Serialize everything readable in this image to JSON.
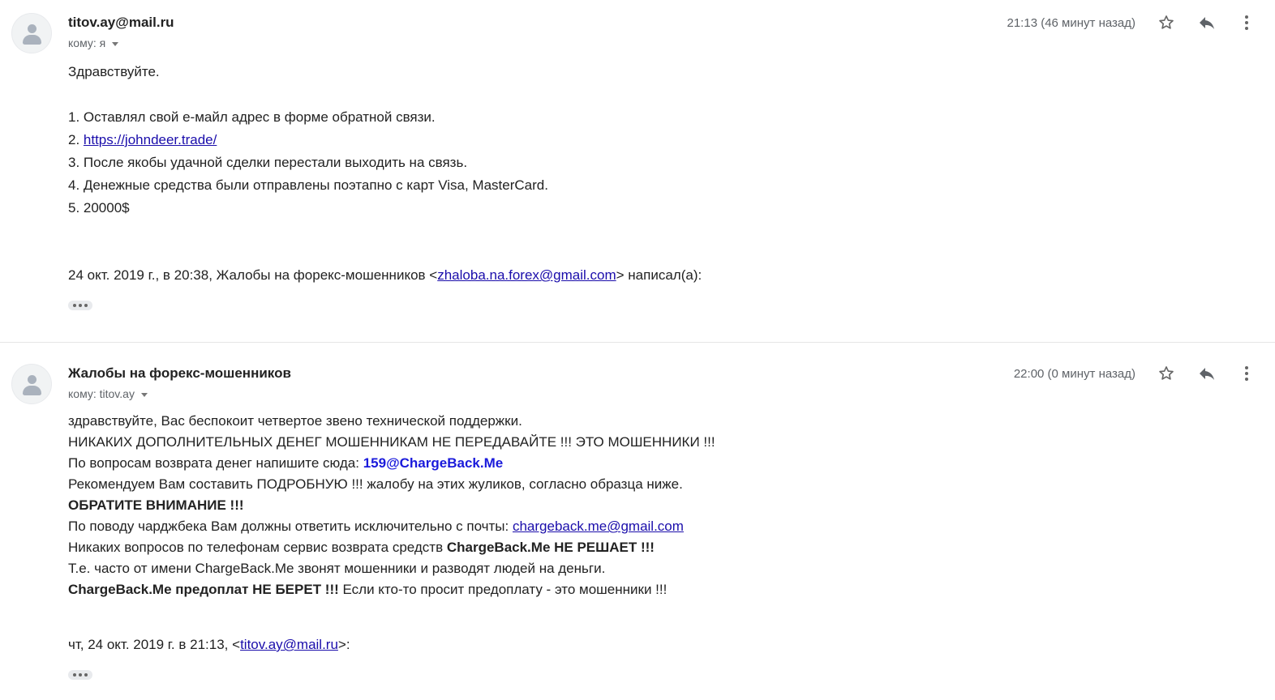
{
  "messages": [
    {
      "sender": "titov.ay@mail.ru",
      "to_label": "кому: я",
      "time": "21:13 (46 минут назад)",
      "icons": [
        "star-icon",
        "reply-icon",
        "more-vert-icon"
      ],
      "body": {
        "greeting": "Здравствуйте.",
        "item1": "1. Оставлял свой е-майл адрес в форме обратной связи.",
        "item2_prefix": "2. ",
        "item2_link": "https://johndeer.trade/",
        "item3": "3. После якобы удачной сделки перестали выходить на связь.",
        "item4": "4. Денежные средства были отправлены поэтапно с карт Visa, MasterCard.",
        "item5": "5. 20000$"
      },
      "quote": {
        "prefix": "24 окт. 2019 г., в 20:38, Жалобы на форекс-мошенников <",
        "email": "zhaloba.na.forex@gmail.com",
        "suffix": "> написал(а):"
      }
    },
    {
      "sender": "Жалобы на форекс-мошенников",
      "to_label": "кому: titov.ay",
      "time": "22:00 (0 минут назад)",
      "icons": [
        "star-icon",
        "reply-icon",
        "more-vert-icon"
      ],
      "body": {
        "line1": "здравствуйте, Вас беспокоит четвертое звено технической поддержки.",
        "line2": "НИКАКИХ ДОПОЛНИТЕЛЬНЫХ ДЕНЕГ МОШЕННИКАМ НЕ ПЕРЕДАВАЙТЕ !!! ЭТО МОШЕННИКИ !!!",
        "line3_prefix": "По вопросам возврата денег напишите сюда: ",
        "line3_link": "159@ChargeBack.Me",
        "line4": "Рекомендуем Вам составить ПОДРОБНУЮ !!! жалобу на этих жуликов, согласно образца ниже.",
        "line5": "ОБРАТИТЕ ВНИМАНИЕ !!!",
        "line6_prefix": "По поводу чарджбека Вам должны ответить исключительно с почты: ",
        "line6_link": "chargeback.me@gmail.com",
        "line7_prefix": "Никаких вопросов по телефонам сервис возврата средств ",
        "line7_bold": "ChargeBack.Me НЕ РЕШАЕТ !!!",
        "line8": "Т.е. часто от имени ChargeBack.Me звонят мошенники и разводят людей на деньги.",
        "line9_bold": "ChargeBack.Me предоплат НЕ БЕРЕТ !!!",
        "line9_suffix": " Если кто-то просит предоплату - это мошенники !!!"
      },
      "quote": {
        "prefix": "чт, 24 окт. 2019 г. в 21:13, <",
        "email": "titov.ay@mail.ru",
        "suffix": ">:"
      }
    }
  ],
  "colors": {
    "link": "#1a0dab",
    "bold_link": "#1a1adb",
    "meta_text": "#5f6368",
    "divider": "#e5e5e5"
  }
}
